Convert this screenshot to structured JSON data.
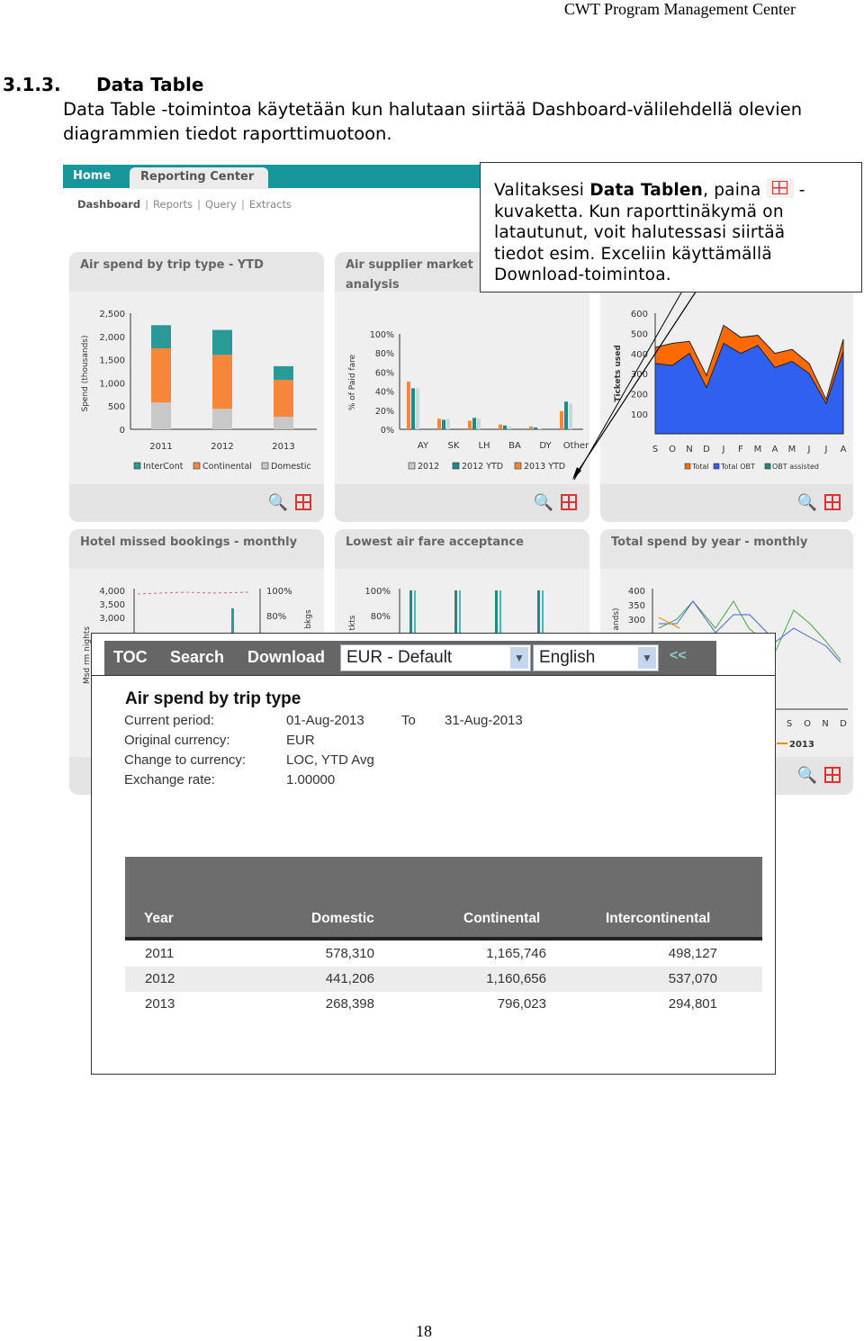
{
  "header": {
    "title": "CWT Program Management Center"
  },
  "section": {
    "number": "3.1.3.",
    "title": "Data Table",
    "paragraph": "Data Table -toimintoa käytetään kun halutaan siirtää Dashboard-välilehdellä olevien diagrammien tiedot raporttimuotoon."
  },
  "app": {
    "tabs": [
      {
        "label": "Home"
      },
      {
        "label": "Reporting Center"
      }
    ],
    "subnav": [
      {
        "label": "Dashboard"
      },
      {
        "label": "Reports"
      },
      {
        "label": "Query"
      },
      {
        "label": "Extracts"
      }
    ],
    "accent": "#17979b",
    "panels": [
      {
        "title": "Air spend by trip type - YTD",
        "ylabel": "Spend (thousands)",
        "yticks": [
          "2,500",
          "2,000",
          "1,500",
          "1,000",
          "500",
          "0"
        ],
        "categories": [
          "2011",
          "2012",
          "2013"
        ],
        "legend": [
          "InterCont",
          "Continental",
          "Domestic"
        ]
      },
      {
        "title": "Air supplier market analysis",
        "ylabel": "% of Paid fare",
        "yticks": [
          "100%",
          "80%",
          "60%",
          "40%",
          "20%",
          "0%"
        ],
        "categories": [
          "AY",
          "SK",
          "LH",
          "BA",
          "DY",
          "Other"
        ],
        "legend": [
          "2012",
          "2012 YTD",
          "2013 YTD"
        ]
      },
      {
        "title": "",
        "ylabel": "Tickets used",
        "yticks": [
          "600",
          "500",
          "400",
          "300",
          "200",
          "100"
        ],
        "categories": [
          "S",
          "O",
          "N",
          "D",
          "J",
          "F",
          "M",
          "A",
          "M",
          "J",
          "J",
          "A"
        ],
        "legend": [
          "Total",
          "Total OBT",
          "OBT assisted"
        ]
      },
      {
        "title": "Hotel missed bookings - monthly",
        "ylabel": "Msd rm nights",
        "yticks": [
          "4,000",
          "3,500",
          "3,000"
        ],
        "y2ticks": [
          "100%",
          "80%"
        ],
        "y2label": "bkgs"
      },
      {
        "title": "Lowest air fare acceptance",
        "ylabel": "tkts",
        "yticks": [
          "100%",
          "80%"
        ]
      },
      {
        "title": "Total spend by year - monthly",
        "ylabel": "ands)",
        "yticks": [
          "400",
          "350",
          "300"
        ],
        "categories": [
          "A",
          "S",
          "O",
          "N",
          "D"
        ],
        "legend": [
          "2013"
        ]
      }
    ]
  },
  "chart_data": [
    {
      "type": "bar",
      "title": "Air spend by trip type - YTD",
      "categories": [
        "2011",
        "2012",
        "2013"
      ],
      "ylim": [
        0,
        2500
      ],
      "series": [
        {
          "name": "Domestic",
          "values": [
            578,
            441,
            268
          ]
        },
        {
          "name": "Continental",
          "values": [
            1166,
            1161,
            796
          ]
        },
        {
          "name": "InterCont",
          "values": [
            498,
            537,
            295
          ]
        }
      ],
      "colors": [
        "#c8c8c8",
        "#f5863a",
        "#2a9a96"
      ]
    },
    {
      "type": "bar",
      "title": "Air supplier market analysis",
      "categories": [
        "AY",
        "SK",
        "LH",
        "BA",
        "DY",
        "Other"
      ],
      "ylim": [
        0,
        100
      ],
      "series": [
        {
          "name": "2013 YTD",
          "values": [
            50,
            11,
            9,
            5,
            3,
            19
          ]
        },
        {
          "name": "2012 YTD",
          "values": [
            43,
            10,
            12,
            4,
            2,
            29
          ]
        },
        {
          "name": "2012",
          "values": [
            43,
            11,
            11,
            3,
            1,
            27
          ]
        }
      ],
      "colors": [
        "#f5863a",
        "#1f8a86",
        "#c8d8d8"
      ]
    },
    {
      "type": "area",
      "categories": [
        "S",
        "O",
        "N",
        "D",
        "J",
        "F",
        "M",
        "A",
        "M",
        "J",
        "J",
        "A"
      ],
      "ylim": [
        0,
        600
      ],
      "series": [
        {
          "name": "Total",
          "values": [
            430,
            450,
            460,
            290,
            540,
            480,
            490,
            400,
            420,
            350,
            170,
            470
          ]
        },
        {
          "name": "Total OBT",
          "values": [
            350,
            340,
            400,
            230,
            450,
            400,
            440,
            330,
            360,
            300,
            150,
            410
          ]
        }
      ],
      "colors": [
        "#ff6a00",
        "#3060f0"
      ]
    }
  ],
  "callout": {
    "pre": "Valitaksesi ",
    "bold": "Data Tablen",
    "post": ", paina",
    "dash": " -",
    "rest": "kuvaketta. Kun raporttinäkymä on latautunut, voit halutessasi siirtää tiedot esim. Exceliin käyttämällä Download-toimintoa."
  },
  "window": {
    "toolbar": {
      "toc": "TOC",
      "search": "Search",
      "download": "Download",
      "currency": "EUR - Default",
      "language": "English",
      "collapse": "<<"
    },
    "title": "Air spend by trip type",
    "meta": [
      {
        "label": "Current period:",
        "value": "01-Aug-2013",
        "to": "To",
        "to_value": "31-Aug-2013"
      },
      {
        "label": "Original currency:",
        "value": "EUR"
      },
      {
        "label": "Change to currency:",
        "value": "LOC, YTD Avg"
      },
      {
        "label": "Exchange rate:",
        "value": "1.00000"
      }
    ],
    "table": {
      "columns": [
        "Year",
        "Domestic",
        "Continental",
        "Intercontinental"
      ],
      "rows": [
        [
          "2011",
          "578,310",
          "1,165,746",
          "498,127"
        ],
        [
          "2012",
          "441,206",
          "1,160,656",
          "537,070"
        ],
        [
          "2013",
          "268,398",
          "796,023",
          "294,801"
        ]
      ]
    }
  },
  "page_number": "18"
}
